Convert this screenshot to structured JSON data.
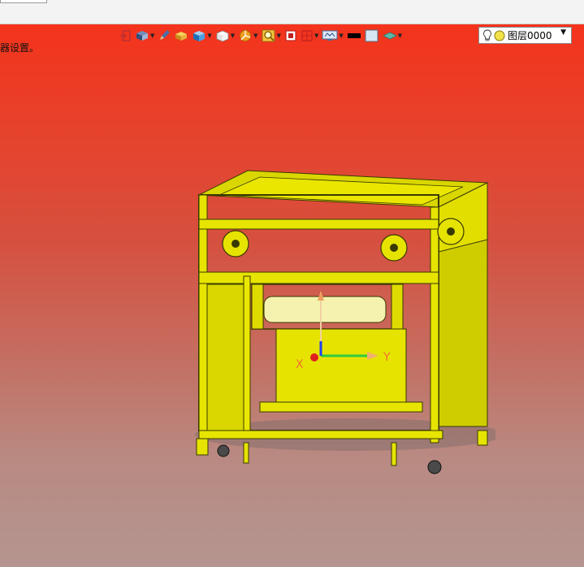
{
  "viewport": {
    "hint_text": "器设置。",
    "layer_label": "图层0000",
    "axis_labels": {
      "x": "X",
      "y": "Y"
    },
    "toolbar_icons": [
      "exit-sketch-icon",
      "view-orientation-icon",
      "pencil-icon",
      "shaded-box-icon",
      "blue-cube-icon",
      "white-cube-icon",
      "section-view-icon",
      "zoom-icon",
      "fit-view-icon",
      "split-view-icon",
      "display-settings-icon",
      "black-rectangle-icon",
      "light-square-icon",
      "surface-icon"
    ]
  },
  "colors": {
    "background_top": "#f4331c",
    "background_bottom": "#b59590",
    "model_yellow": "#e3e000",
    "model_edge": "#3a3a00"
  }
}
